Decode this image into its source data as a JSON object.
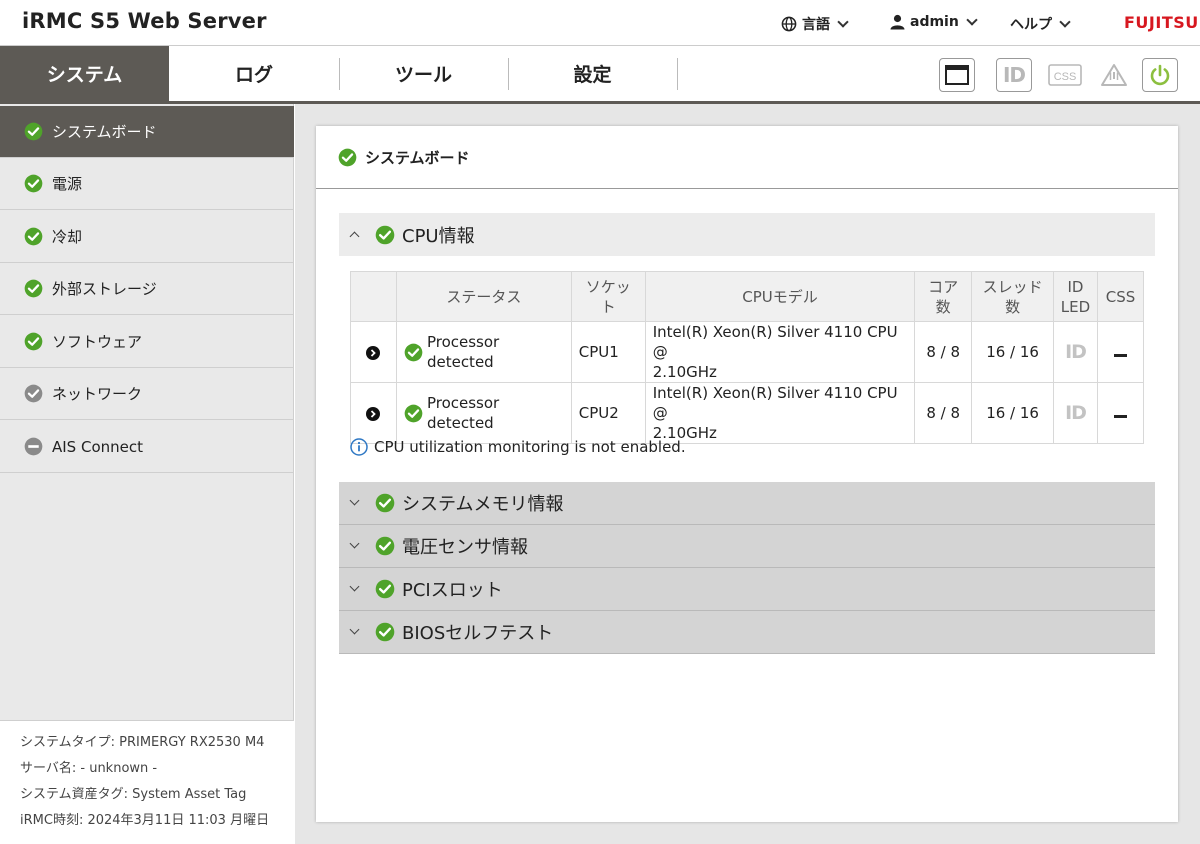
{
  "app": {
    "title": "iRMC S5 Web Server",
    "brand": "FUJITSU"
  },
  "topmenu": {
    "language": "言語",
    "user": "admin",
    "help": "ヘルプ"
  },
  "tabs": [
    "システム",
    "ログ",
    "ツール",
    "設定"
  ],
  "tools": [
    "window-icon",
    "id-icon",
    "css-icon",
    "warning-icon",
    "power-icon"
  ],
  "sidebar": {
    "items": [
      {
        "label": "システムボード",
        "status": "ok"
      },
      {
        "label": "電源",
        "status": "ok"
      },
      {
        "label": "冷却",
        "status": "ok"
      },
      {
        "label": "外部ストレージ",
        "status": "ok"
      },
      {
        "label": "ソフトウェア",
        "status": "ok"
      },
      {
        "label": "ネットワーク",
        "status": "unknown"
      },
      {
        "label": "AIS Connect",
        "status": "disabled"
      }
    ]
  },
  "sysinfo": {
    "system_type": "システムタイプ: PRIMERGY RX2530 M4",
    "server_name": "サーバ名: - unknown -",
    "asset_tag": "システム資産タグ: System Asset Tag",
    "irmc_time": "iRMC時刻: 2024年3月11日 11:03 月曜日"
  },
  "panel": {
    "title": "システムボード"
  },
  "sections": [
    {
      "label": "CPU情報",
      "expanded": true
    },
    {
      "label": "システムメモリ情報",
      "expanded": false
    },
    {
      "label": "電圧センサ情報",
      "expanded": false
    },
    {
      "label": "PCIスロット",
      "expanded": false
    },
    {
      "label": "BIOSセルフテスト",
      "expanded": false
    }
  ],
  "cpu_table": {
    "headers": {
      "status": "ステータス",
      "socket_line1": "ソケッ",
      "socket_line2": "ト",
      "model": "CPUモデル",
      "cores_line1": "コア",
      "cores_line2": "数",
      "threads_line1": "スレッド",
      "threads_line2": "数",
      "idled_line1": "ID",
      "idled_line2": "LED",
      "css": "CSS"
    },
    "rows": [
      {
        "status": "Processor detected",
        "socket": "CPU1",
        "model_line1": "Intel(R) Xeon(R) Silver 4110 CPU @",
        "model_line2": "2.10GHz",
        "cores": "8 / 8",
        "threads": "16 / 16",
        "idled": "ID"
      },
      {
        "status": "Processor detected",
        "socket": "CPU2",
        "model_line1": "Intel(R) Xeon(R) Silver 4110 CPU @",
        "model_line2": "2.10GHz",
        "cores": "8 / 8",
        "threads": "16 / 16",
        "idled": "ID"
      }
    ],
    "note": "CPU utilization monitoring is not enabled."
  },
  "colors": {
    "ok": "#4fa32a",
    "unknown": "#8a8a8a",
    "active_tab": "#5d5a55",
    "brand": "#d7171f"
  }
}
